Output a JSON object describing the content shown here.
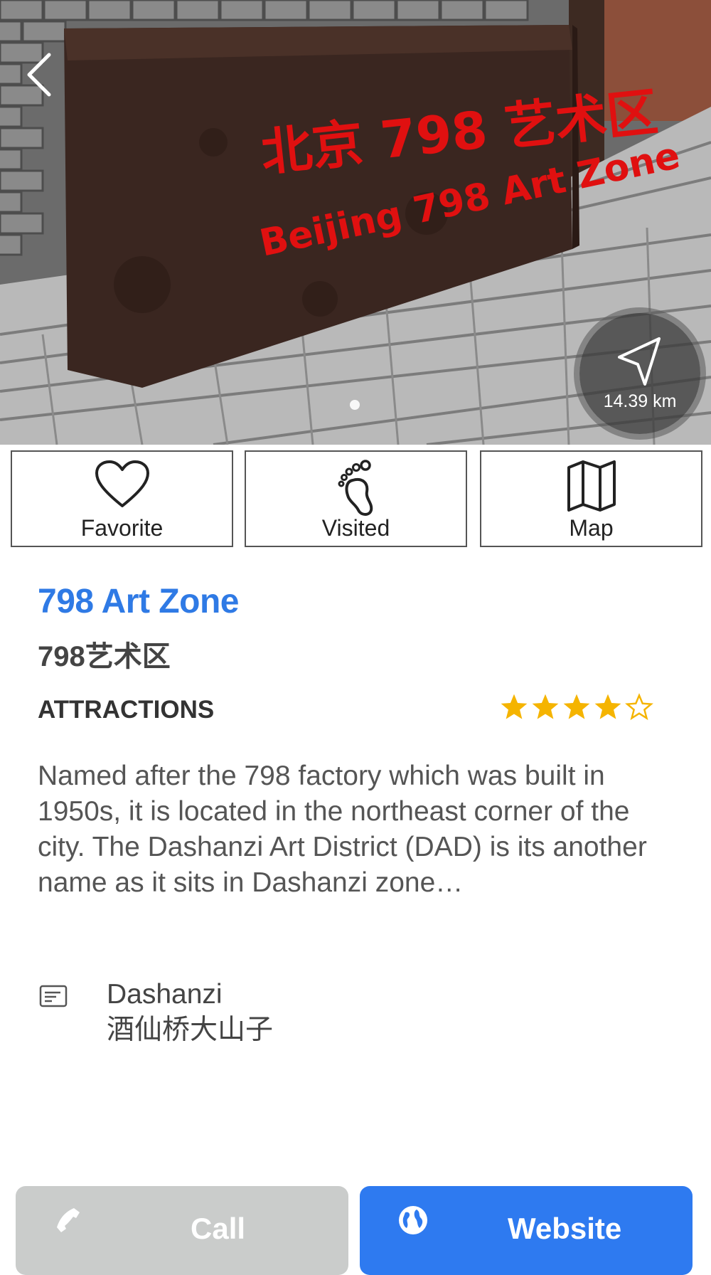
{
  "hero": {
    "sign_zh": "北京 798 艺术区",
    "sign_en": "Beijing 798 Art Zone",
    "distance": "14.39 km"
  },
  "actions": [
    {
      "label": "Favorite",
      "icon": "heart-icon"
    },
    {
      "label": "Visited",
      "icon": "footprint-icon"
    },
    {
      "label": "Map",
      "icon": "map-icon"
    }
  ],
  "place": {
    "name_en": "798 Art Zone",
    "name_zh": "798艺术区",
    "category": "ATTRACTIONS",
    "rating": 4,
    "rating_max": 5,
    "description": "Named after the 798 factory which was built in 1950s, it is located in the northeast corner of the city. The Dashanzi Art District (DAD) is its another name as it sits in Dashanzi zone…",
    "address_en": "Dashanzi",
    "address_zh": "酒仙桥大山子"
  },
  "bottom": {
    "call_label": "Call",
    "website_label": "Website"
  },
  "colors": {
    "accent": "#2f7ae5",
    "star": "#f5b400",
    "website_button": "#2e7af0",
    "call_button": "#cacccb"
  }
}
